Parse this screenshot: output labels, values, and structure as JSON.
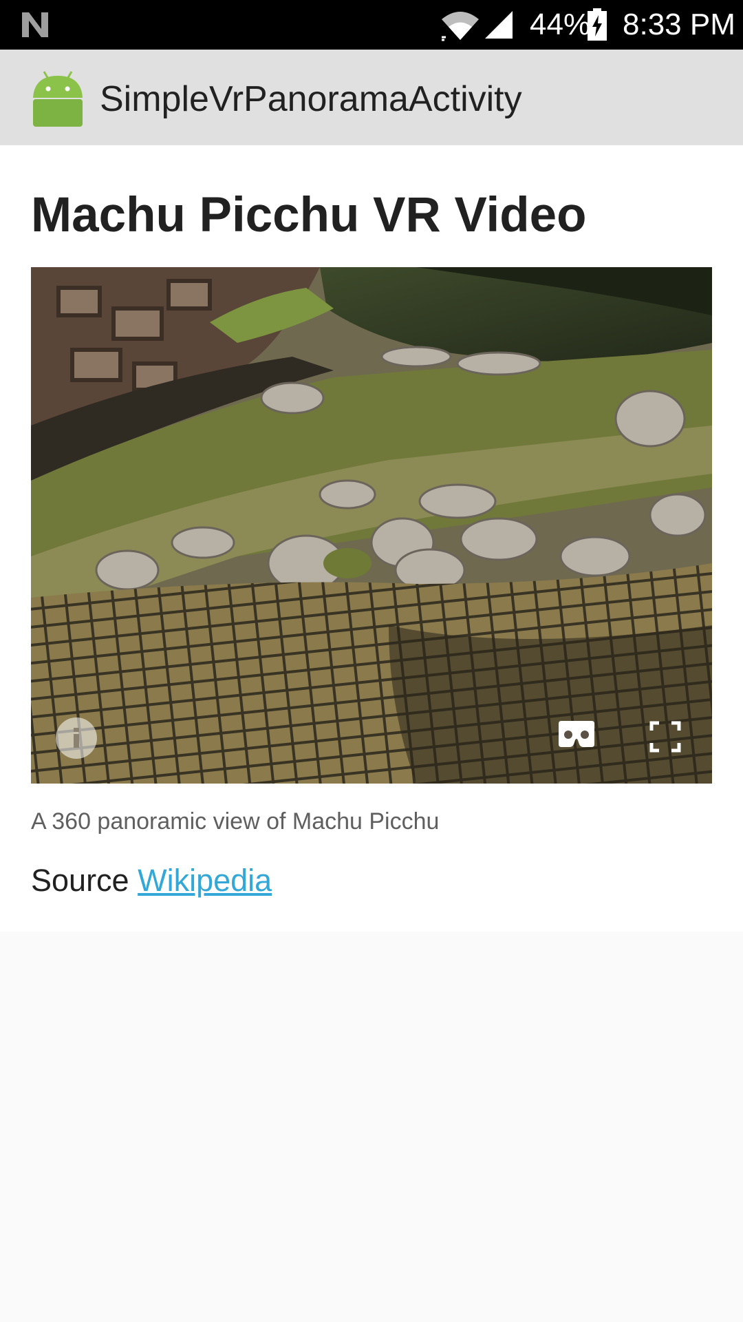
{
  "status_bar": {
    "battery_percent": "44%",
    "time": "8:33 PM",
    "icons": [
      "notification-n-icon",
      "wifi-icon",
      "signal-icon",
      "battery-charging-icon"
    ]
  },
  "app_bar": {
    "title": "SimpleVrPanoramaActivity",
    "icon": "android-robot-icon"
  },
  "content": {
    "title": "Machu Picchu VR Video",
    "caption": "A 360 panoramic view of Machu Picchu",
    "source_label": "Source",
    "source_link": "Wikipedia"
  },
  "panorama_controls": {
    "icons": [
      "info-icon",
      "cardboard-icon",
      "fullscreen-icon"
    ]
  },
  "colors": {
    "link": "#33a8d8",
    "app_bar": "#e0e0e0",
    "android_green": "#8bc34a"
  }
}
